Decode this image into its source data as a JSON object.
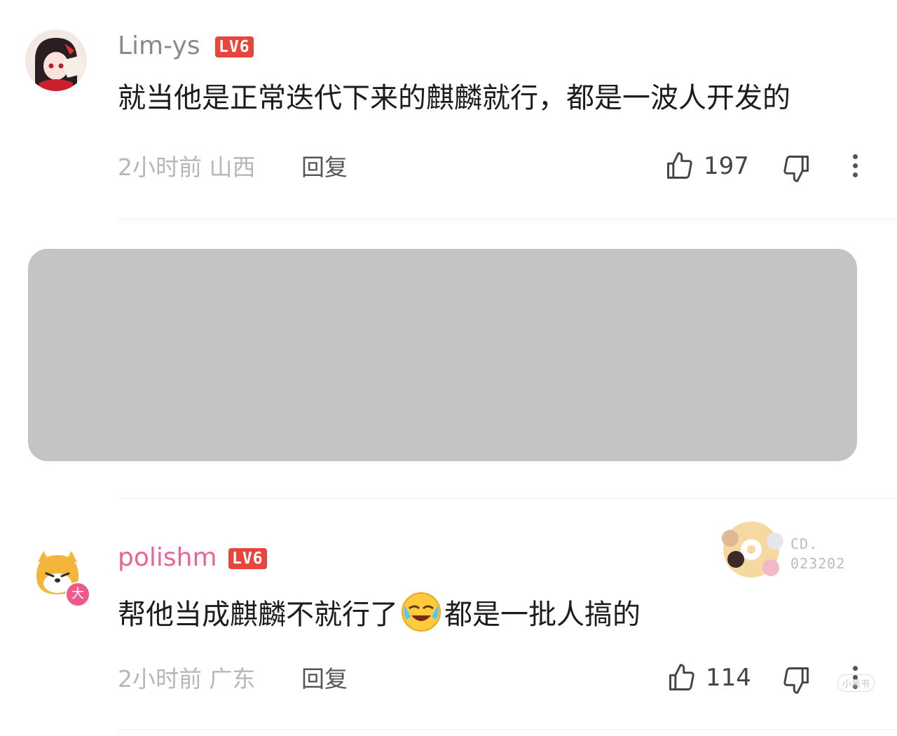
{
  "comments": [
    {
      "username": "Lim-ys",
      "level": "LV6",
      "text": "就当他是正常迭代下来的麒麟就行，都是一波人开发的",
      "time_location": "2小时前 山西",
      "reply_label": "回复",
      "likes": "197",
      "username_color": "#8a8a8a"
    },
    {
      "username": "polishm",
      "level": "LV6",
      "text_before": "帮他当成麒麟不就行了",
      "text_after": "都是一批人搞的",
      "time_location": "2小时前 广东",
      "reply_label": "回复",
      "likes": "114",
      "username_color": "#e8649a",
      "avatar_badge": "大",
      "card_code_1": "CD.",
      "card_code_2": "023202"
    }
  ],
  "colors": {
    "level_badge": "#e8453c",
    "redaction": "#c4c4c4"
  },
  "watermark": "小黑书"
}
